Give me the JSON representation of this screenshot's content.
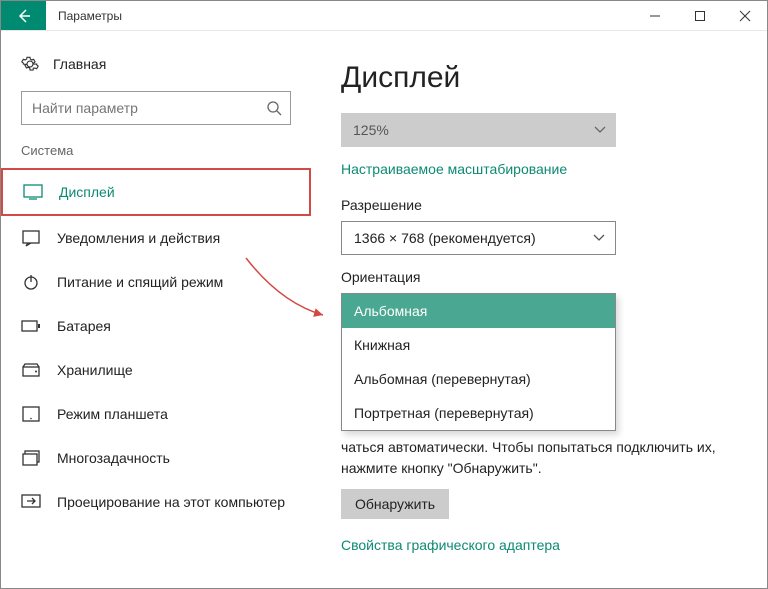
{
  "titlebar": {
    "title": "Параметры"
  },
  "sidebar": {
    "home": "Главная",
    "search_placeholder": "Найти параметр",
    "group": "Система",
    "items": [
      {
        "label": "Дисплей"
      },
      {
        "label": "Уведомления и действия"
      },
      {
        "label": "Питание и спящий режим"
      },
      {
        "label": "Батарея"
      },
      {
        "label": "Хранилище"
      },
      {
        "label": "Режим планшета"
      },
      {
        "label": "Многозадачность"
      },
      {
        "label": "Проецирование на этот компьютер"
      }
    ]
  },
  "content": {
    "heading": "Дисплей",
    "scale_value": "125%",
    "custom_scaling": "Настраиваемое масштабирование",
    "resolution_label": "Разрешение",
    "resolution_value": "1366 × 768 (рекомендуется)",
    "orientation_label": "Ориентация",
    "orientation_options": [
      "Альбомная",
      "Книжная",
      "Альбомная (перевернутая)",
      "Портретная (перевернутая)"
    ],
    "detect_text_tail": "чаться автоматически. Чтобы попытаться подключить их, нажмите кнопку \"Обнаружить\".",
    "detect_button": "Обнаружить",
    "gpu_link": "Свойства графического адаптера"
  }
}
